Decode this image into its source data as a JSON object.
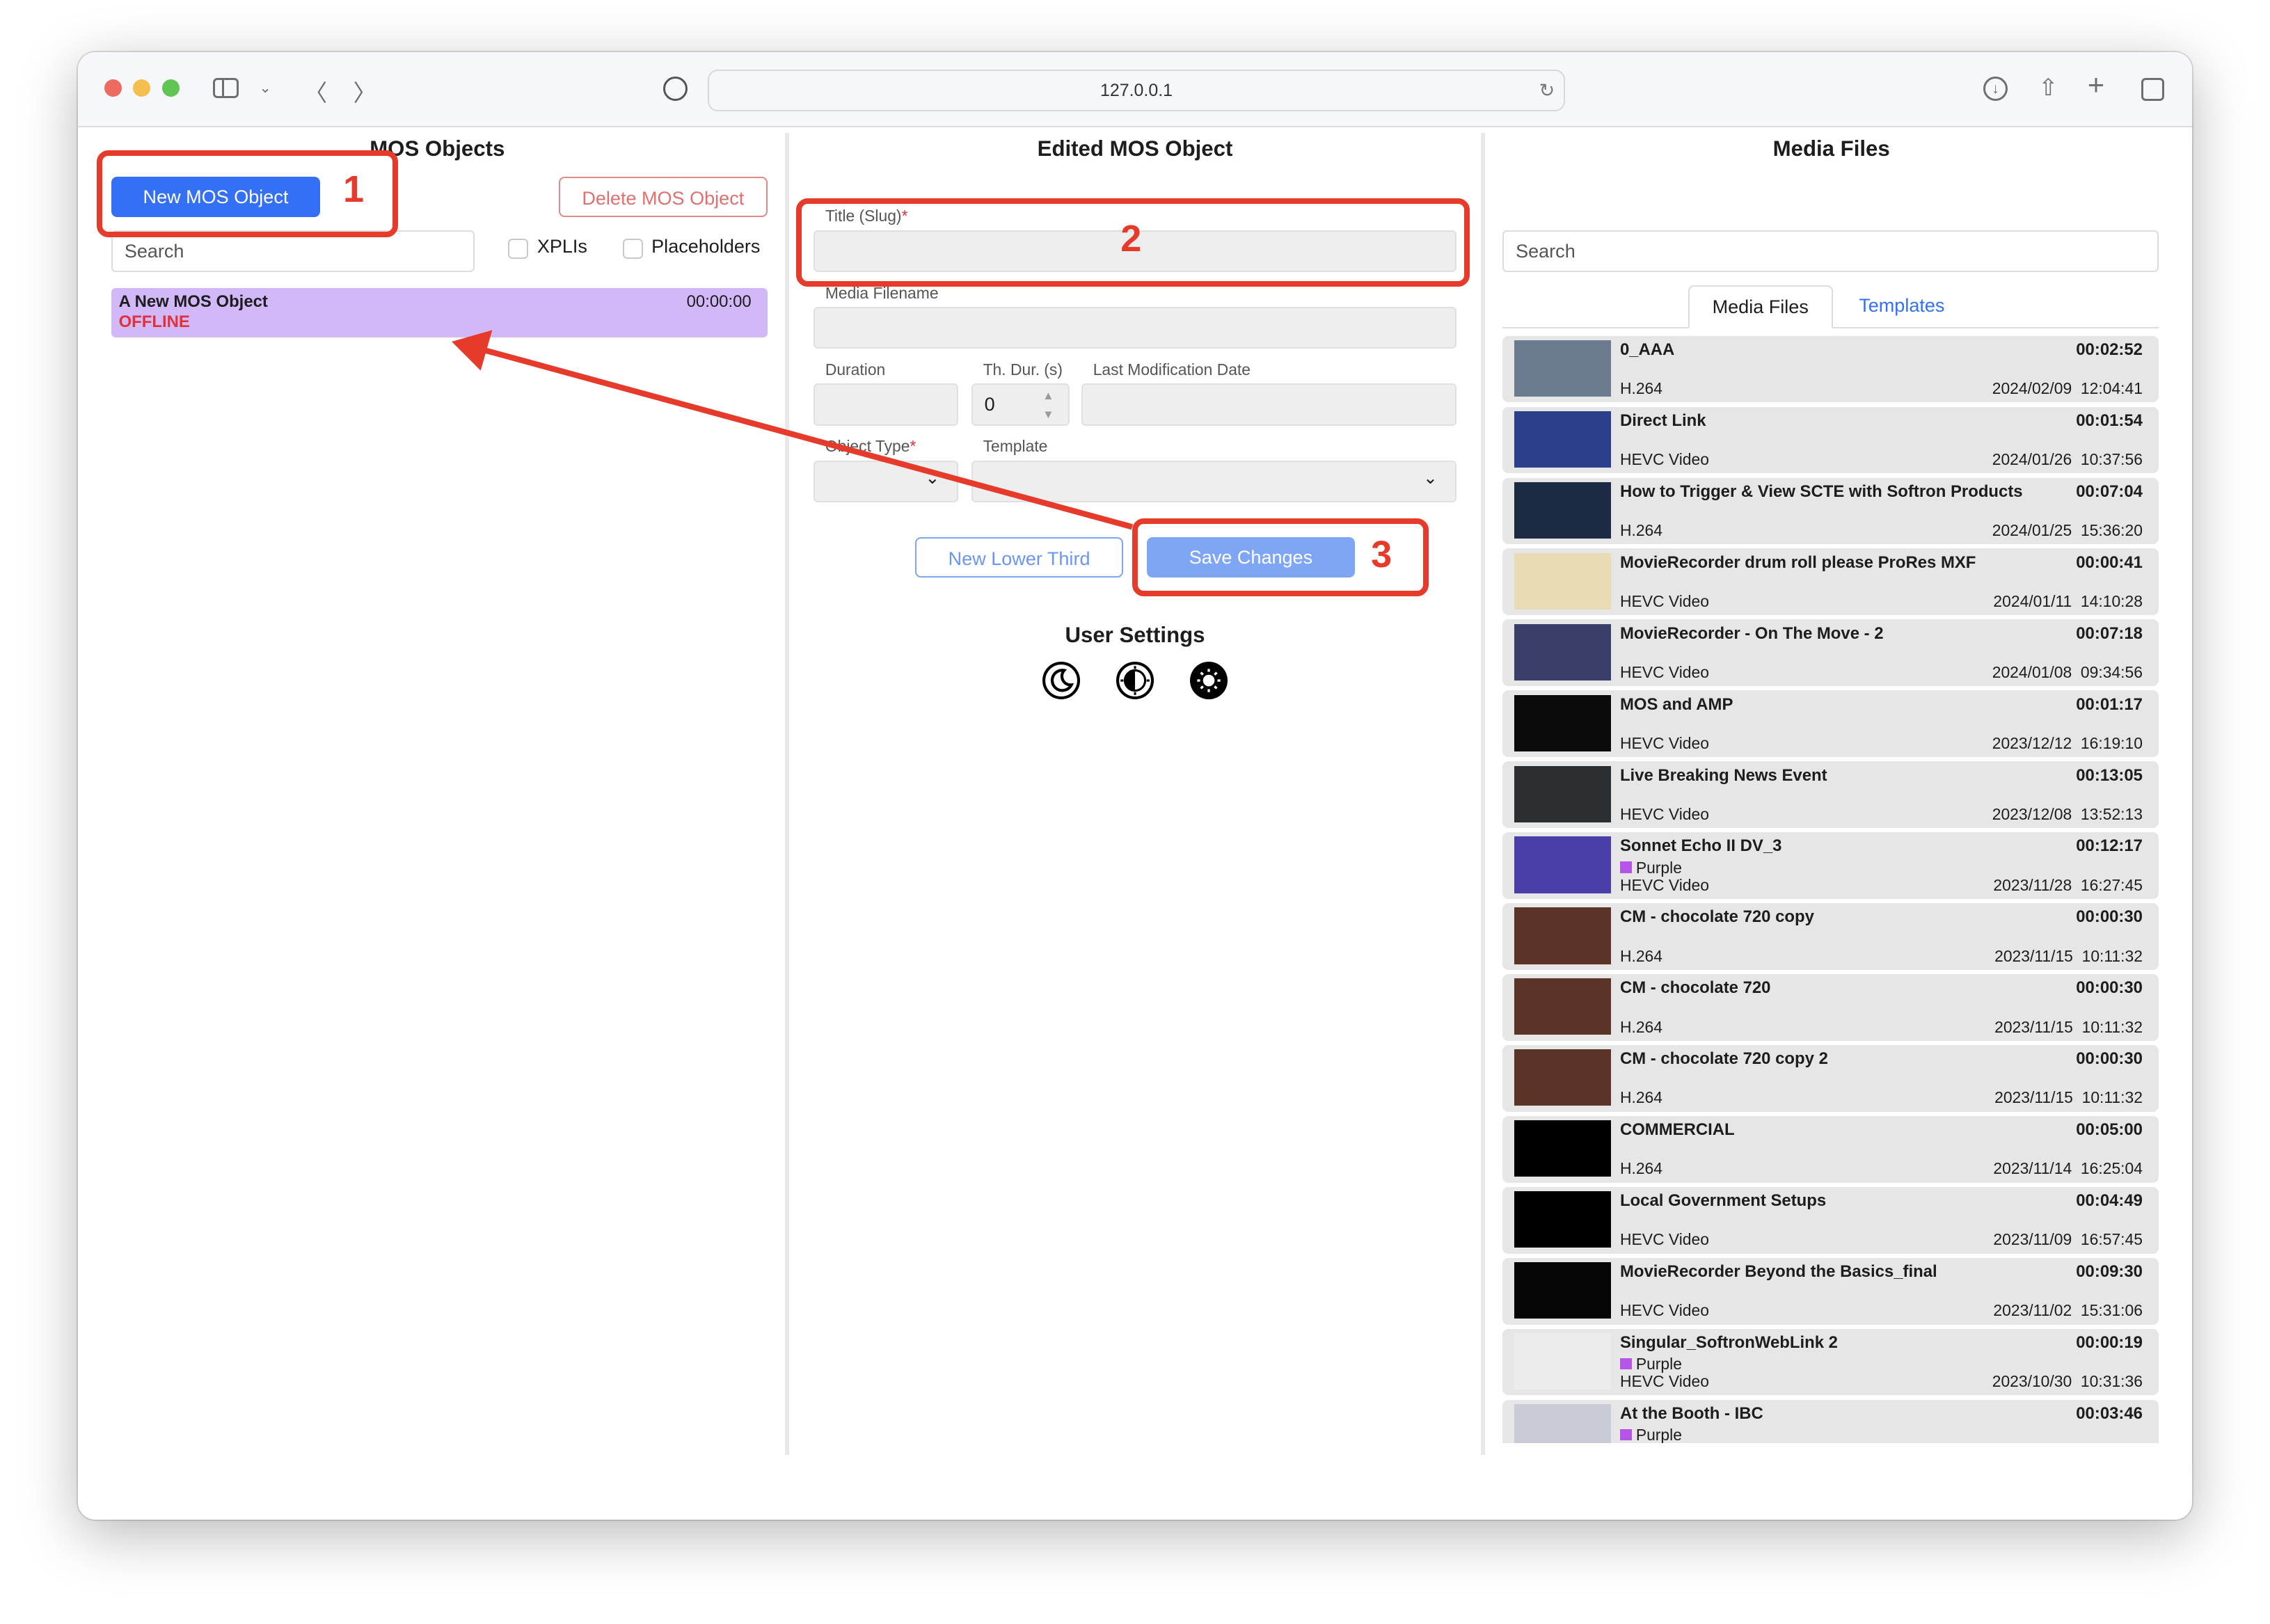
{
  "browser": {
    "url": "127.0.0.1"
  },
  "colors": {
    "accent": "#3370f5",
    "annotation": "#e63b2a",
    "selected_item": "#d3b8f7",
    "offline": "#e0303a",
    "tag_purple": "#b455e8"
  },
  "left": {
    "title": "MOS Objects",
    "new_button": "New MOS Object",
    "delete_button": "Delete MOS Object",
    "search_placeholder": "Search",
    "xplis": "XPLIs",
    "placeholders": "Placeholders",
    "items": [
      {
        "title": "A New MOS Object",
        "duration": "00:00:00",
        "status": "OFFLINE"
      }
    ]
  },
  "middle": {
    "title": "Edited MOS Object",
    "title_label": "Title (Slug)",
    "media_filename_label": "Media Filename",
    "duration_label": "Duration",
    "th_dur_label": "Th. Dur. (s)",
    "th_dur_value": "0",
    "last_mod_label": "Last Modification Date",
    "object_type_label": "Object Type",
    "template_label": "Template",
    "new_lower_third": "New Lower Third",
    "save_changes": "Save Changes",
    "user_settings": "User Settings",
    "theme_icons": [
      "moon-icon",
      "auto-theme-icon",
      "sun-icon"
    ]
  },
  "annotations": [
    "1",
    "2",
    "3"
  ],
  "right": {
    "title": "Media Files",
    "search_placeholder": "Search",
    "tabs": [
      "Media Files",
      "Templates"
    ],
    "active_tab": "Media Files",
    "items": [
      {
        "title": "0_AAA",
        "duration": "00:02:52",
        "codec": "H.264",
        "date": "2024/02/09  12:04:41",
        "thumb": "#6b7a8c"
      },
      {
        "title": "Direct Link",
        "duration": "00:01:54",
        "codec": "HEVC Video",
        "date": "2024/01/26  10:37:56",
        "thumb": "#2a3f8a"
      },
      {
        "title": "How to Trigger & View SCTE with Softron Products",
        "duration": "00:07:04",
        "codec": "H.264",
        "date": "2024/01/25  15:36:20",
        "thumb": "#1c2a44"
      },
      {
        "title": "MovieRecorder drum roll please ProRes MXF",
        "duration": "00:00:41",
        "codec": "HEVC Video",
        "date": "2024/01/11  14:10:28",
        "thumb": "#e9dcb5"
      },
      {
        "title": "MovieRecorder - On The Move - 2",
        "duration": "00:07:18",
        "codec": "HEVC Video",
        "date": "2024/01/08  09:34:56",
        "thumb": "#3a3f6a"
      },
      {
        "title": "MOS and AMP",
        "duration": "00:01:17",
        "codec": "HEVC Video",
        "date": "2023/12/12  16:19:10",
        "thumb": "#0a0a0a"
      },
      {
        "title": "Live Breaking News Event",
        "duration": "00:13:05",
        "codec": "HEVC Video",
        "date": "2023/12/08  13:52:13",
        "thumb": "#2b2e30"
      },
      {
        "title": "Sonnet Echo II DV_3",
        "label": "Purple",
        "duration": "00:12:17",
        "codec": "HEVC Video",
        "date": "2023/11/28  16:27:45",
        "thumb": "#4a3fa8"
      },
      {
        "title": "CM - chocolate 720 copy",
        "duration": "00:00:30",
        "codec": "H.264",
        "date": "2023/11/15  10:11:32",
        "thumb": "#5a3426"
      },
      {
        "title": "CM - chocolate 720",
        "duration": "00:00:30",
        "codec": "H.264",
        "date": "2023/11/15  10:11:32",
        "thumb": "#5a3426"
      },
      {
        "title": "CM - chocolate 720 copy 2",
        "duration": "00:00:30",
        "codec": "H.264",
        "date": "2023/11/15  10:11:32",
        "thumb": "#5a3426"
      },
      {
        "title": "COMMERCIAL",
        "duration": "00:05:00",
        "codec": "H.264",
        "date": "2023/11/14  16:25:04",
        "thumb": "#000000"
      },
      {
        "title": "Local Government Setups",
        "duration": "00:04:49",
        "codec": "HEVC Video",
        "date": "2023/11/09  16:57:45",
        "thumb": "#000000"
      },
      {
        "title": "MovieRecorder Beyond the Basics_final",
        "duration": "00:09:30",
        "codec": "HEVC Video",
        "date": "2023/11/02  15:31:06",
        "thumb": "#050505"
      },
      {
        "title": "Singular_SoftronWebLink 2",
        "label": "Purple",
        "duration": "00:00:19",
        "codec": "HEVC Video",
        "date": "2023/10/30  10:31:36",
        "thumb": "#ececec"
      },
      {
        "title": "At the Booth - IBC",
        "label": "Purple",
        "duration": "00:03:46",
        "thumb": "#c9ccd4"
      }
    ]
  }
}
